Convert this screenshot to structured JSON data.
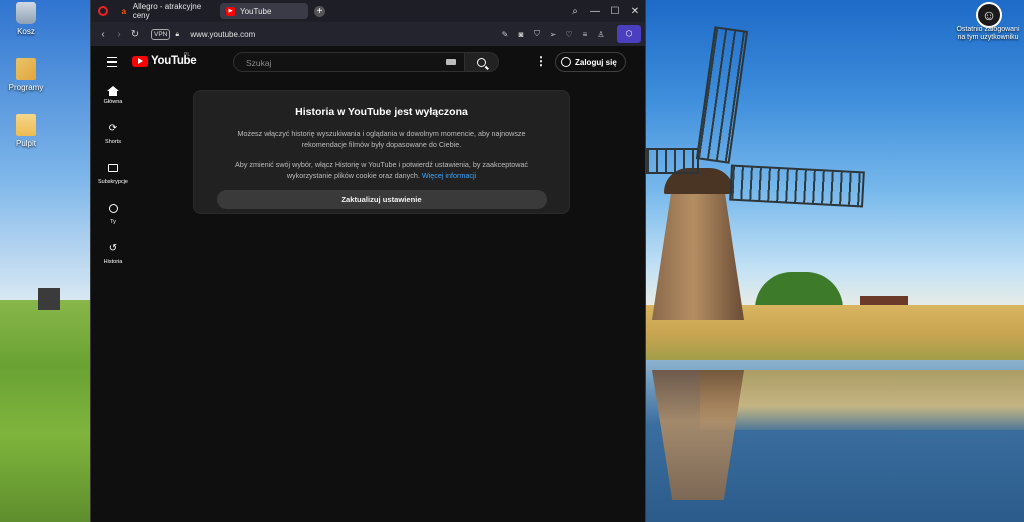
{
  "desktop": {
    "icons": [
      {
        "label": "Kosz"
      },
      {
        "label": "Programy"
      },
      {
        "label": "Pulpit"
      }
    ],
    "login_hint": "Ostatnio zalogowani na tym użytkowniku"
  },
  "browser": {
    "tabs": [
      {
        "title": "Allegro - atrakcyjne ceny",
        "favicon": "allegro-icon"
      },
      {
        "title": "YouTube",
        "favicon": "youtube-icon"
      }
    ],
    "new_tab": "+",
    "window_controls": {
      "search": "⌕",
      "minimize": "—",
      "maximize": "☐",
      "close": "✕"
    },
    "vpn_badge": "VPN",
    "url": "www.youtube.com"
  },
  "youtube": {
    "logo_text": "YouTube",
    "country_code": "PL",
    "search_placeholder": "Szukaj",
    "sign_in_label": "Zaloguj się",
    "guide": [
      {
        "label": "Główna"
      },
      {
        "label": "Shorts"
      },
      {
        "label": "Subskrypcje"
      },
      {
        "label": "Ty"
      },
      {
        "label": "Historia"
      }
    ],
    "history_card": {
      "title": "Historia w YouTube jest wyłączona",
      "paragraph1": "Możesz włączyć historię wyszukiwania i oglądania w dowolnym momencie, aby najnowsze rekomendacje filmów były dopasowane do Ciebie.",
      "paragraph2": "Aby zmienić swój wybór, włącz Historię w YouTube i potwierdź ustawienia, by zaakceptować wykorzystanie plików cookie oraz danych.",
      "more_link": "Więcej informacji",
      "button": "Zaktualizuj ustawienie"
    }
  },
  "colors": {
    "yt_red": "#ff0000",
    "link_blue": "#3ea6ff",
    "page_bg": "#0f0f0f"
  }
}
